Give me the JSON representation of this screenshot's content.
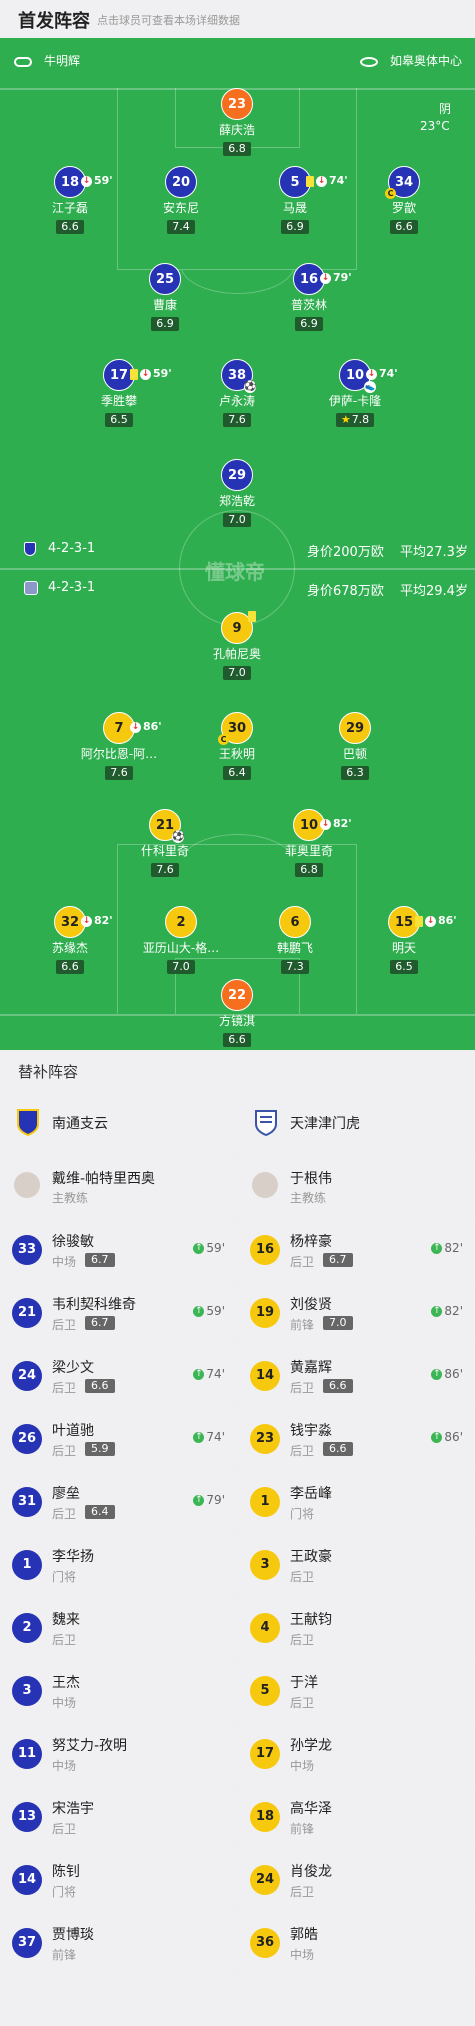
{
  "header": {
    "title": "首发阵容",
    "subtitle": "点击球员可查看本场详细数据"
  },
  "pitch_info": {
    "referee": "牛明辉",
    "venue": "如皋奥体中心",
    "weather": "阴",
    "temperature": "23°C",
    "watermark": "懂球帝",
    "home": {
      "formation": "4-2-3-1",
      "value": "身价200万欧",
      "avg_age": "平均27.3岁"
    },
    "away": {
      "formation": "4-2-3-1",
      "value": "身价678万欧",
      "avg_age": "平均29.4岁"
    }
  },
  "home_players": [
    {
      "num": "23",
      "name": "薛庆浩",
      "rating": "6.8",
      "gk": true
    },
    {
      "num": "18",
      "name": "江子磊",
      "rating": "6.6",
      "sub_out": "59'"
    },
    {
      "num": "20",
      "name": "安东尼",
      "rating": "7.4"
    },
    {
      "num": "5",
      "name": "马晟",
      "rating": "6.9",
      "yellow": true,
      "sub_out": "74'"
    },
    {
      "num": "34",
      "name": "罗歆",
      "rating": "6.6",
      "captain": true
    },
    {
      "num": "25",
      "name": "曹康",
      "rating": "6.9"
    },
    {
      "num": "16",
      "name": "普茨林",
      "rating": "6.9",
      "sub_out": "79'"
    },
    {
      "num": "17",
      "name": "季胜攀",
      "rating": "6.5",
      "yellow": true,
      "sub_out": "59'"
    },
    {
      "num": "38",
      "name": "卢永涛",
      "rating": "7.6",
      "goal": true
    },
    {
      "num": "10",
      "name": "伊萨-卡隆",
      "rating": "7.8",
      "sub_out": "74'",
      "assist": true,
      "star": true
    },
    {
      "num": "29",
      "name": "郑浩乾",
      "rating": "7.0"
    }
  ],
  "away_players": [
    {
      "num": "9",
      "name": "孔帕尼奥",
      "rating": "7.0",
      "yellow": true
    },
    {
      "num": "7",
      "name": "阿尔比恩-阿…",
      "rating": "7.6",
      "sub_out": "86'"
    },
    {
      "num": "30",
      "name": "王秋明",
      "rating": "6.4",
      "captain": true
    },
    {
      "num": "29",
      "name": "巴顿",
      "rating": "6.3"
    },
    {
      "num": "21",
      "name": "什科里奇",
      "rating": "7.6",
      "goal": true
    },
    {
      "num": "10",
      "name": "菲奥里奇",
      "rating": "6.8",
      "sub_out": "82'"
    },
    {
      "num": "32",
      "name": "苏缘杰",
      "rating": "6.6",
      "sub_out": "82'"
    },
    {
      "num": "2",
      "name": "亚历山大-格…",
      "rating": "7.0"
    },
    {
      "num": "6",
      "name": "韩鹏飞",
      "rating": "7.3"
    },
    {
      "num": "15",
      "name": "明天",
      "rating": "6.5",
      "yellow": true,
      "sub_out": "86'"
    },
    {
      "num": "22",
      "name": "方镜淇",
      "rating": "6.6",
      "gk": true
    }
  ],
  "subs_title": "替补阵容",
  "home_team": {
    "name": "南通支云",
    "coach": "戴维-帕特里西奥",
    "coach_role": "主教练",
    "subs": [
      {
        "num": "33",
        "name": "徐骏敏",
        "pos": "中场",
        "rating": "6.7",
        "in": "59'"
      },
      {
        "num": "21",
        "name": "韦利契科维奇",
        "pos": "后卫",
        "rating": "6.7",
        "in": "59'"
      },
      {
        "num": "24",
        "name": "梁少文",
        "pos": "后卫",
        "rating": "6.6",
        "in": "74'"
      },
      {
        "num": "26",
        "name": "叶道驰",
        "pos": "后卫",
        "rating": "5.9",
        "in": "74'"
      },
      {
        "num": "31",
        "name": "廖垒",
        "pos": "后卫",
        "rating": "6.4",
        "in": "79'"
      },
      {
        "num": "1",
        "name": "李华扬",
        "pos": "门将"
      },
      {
        "num": "2",
        "name": "魏来",
        "pos": "后卫"
      },
      {
        "num": "3",
        "name": "王杰",
        "pos": "中场"
      },
      {
        "num": "11",
        "name": "努艾力-孜明",
        "pos": "中场"
      },
      {
        "num": "13",
        "name": "宋浩宇",
        "pos": "后卫"
      },
      {
        "num": "14",
        "name": "陈钊",
        "pos": "门将"
      },
      {
        "num": "37",
        "name": "贾博琰",
        "pos": "前锋"
      }
    ]
  },
  "away_team": {
    "name": "天津津门虎",
    "coach": "于根伟",
    "coach_role": "主教练",
    "subs": [
      {
        "num": "16",
        "name": "杨梓豪",
        "pos": "后卫",
        "rating": "6.7",
        "in": "82'"
      },
      {
        "num": "19",
        "name": "刘俊贤",
        "pos": "前锋",
        "rating": "7.0",
        "in": "82'"
      },
      {
        "num": "14",
        "name": "黄嘉辉",
        "pos": "后卫",
        "rating": "6.6",
        "in": "86'"
      },
      {
        "num": "23",
        "name": "钱宇淼",
        "pos": "后卫",
        "rating": "6.6",
        "in": "86'"
      },
      {
        "num": "1",
        "name": "李岳峰",
        "pos": "门将"
      },
      {
        "num": "3",
        "name": "王政豪",
        "pos": "后卫"
      },
      {
        "num": "4",
        "name": "王献钧",
        "pos": "后卫"
      },
      {
        "num": "5",
        "name": "于洋",
        "pos": "后卫"
      },
      {
        "num": "17",
        "name": "孙学龙",
        "pos": "中场"
      },
      {
        "num": "18",
        "name": "高华泽",
        "pos": "前锋"
      },
      {
        "num": "24",
        "name": "肖俊龙",
        "pos": "后卫"
      },
      {
        "num": "36",
        "name": "郭皓",
        "pos": "中场"
      }
    ]
  },
  "colors": {
    "pitch": "#2fae4f",
    "home": "#2533b4",
    "away": "#f6c90e",
    "gk": "#f56f1e",
    "rating_bg": "#1f5b2c"
  },
  "icons": {
    "referee": "whistle-icon",
    "venue": "stadium-icon",
    "sub_out": "sub-out-icon",
    "sub_in": "sub-in-icon",
    "captain": "captain-icon",
    "goal": "ball-icon",
    "yellow": "yellow-card-icon"
  }
}
